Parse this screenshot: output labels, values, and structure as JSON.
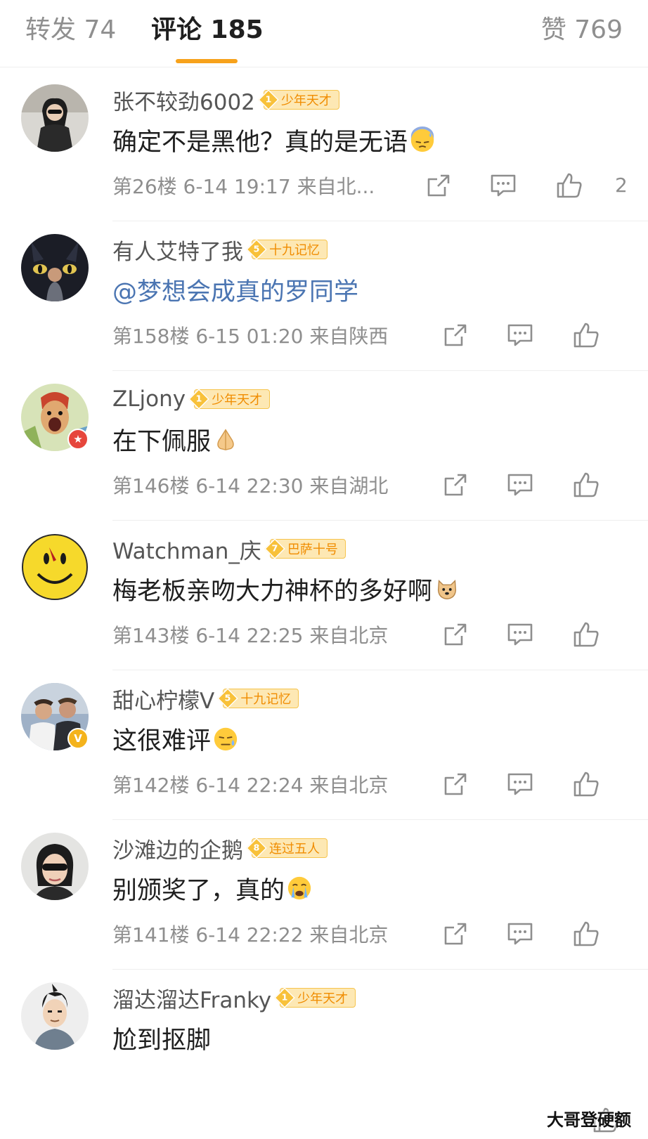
{
  "tabs": {
    "repost": "转发 74",
    "comments": "评论 185",
    "likes": "赞 769",
    "active": "comments",
    "accent_color": "#f7a21b"
  },
  "comments": [
    {
      "username": "张不较劲6002",
      "fan_level": "1",
      "fan_title": "少年天才",
      "text": "确定不是黑他？真的是无语",
      "emoji_icon": "sweat-face-emoji",
      "meta": "第26楼 6-14 19:17 来自北...",
      "like_count": "2"
    },
    {
      "username": "有人艾特了我",
      "fan_level": "5",
      "fan_title": "十九记忆",
      "text": "@梦想会成真的罗同学",
      "meta": "第158楼 6-15 01:20 来自陕西",
      "like_count": ""
    },
    {
      "username": "ZLjony",
      "fan_level": "1",
      "fan_title": "少年天才",
      "text": "在下佩服",
      "emoji_icon": "clasped-hands-emoji",
      "meta": "第146楼 6-14 22:30 来自湖北",
      "like_count": ""
    },
    {
      "username": "Watchman_庆",
      "fan_level": "7",
      "fan_title": "巴萨十号",
      "text": "梅老板亲吻大力神杯的多好啊",
      "emoji_icon": "doge-emoji",
      "meta": "第143楼 6-14 22:25 来自北京",
      "like_count": ""
    },
    {
      "username": "甜心柠檬V",
      "fan_level": "5",
      "fan_title": "十九记忆",
      "text": "这很难评",
      "emoji_icon": "awkward-sweat-emoji",
      "meta": "第142楼 6-14 22:24 来自北京",
      "like_count": ""
    },
    {
      "username": "沙滩边的企鹅",
      "fan_level": "8",
      "fan_title": "连过五人",
      "text": "别颁奖了，真的",
      "emoji_icon": "crying-face-emoji",
      "meta": "第141楼 6-14 22:22 来自北京",
      "like_count": ""
    },
    {
      "username": "溜达溜达Franky",
      "fan_level": "1",
      "fan_title": "少年天才",
      "text": "尬到抠脚",
      "meta": "",
      "like_count": ""
    }
  ],
  "watermark": "大哥登硬额"
}
